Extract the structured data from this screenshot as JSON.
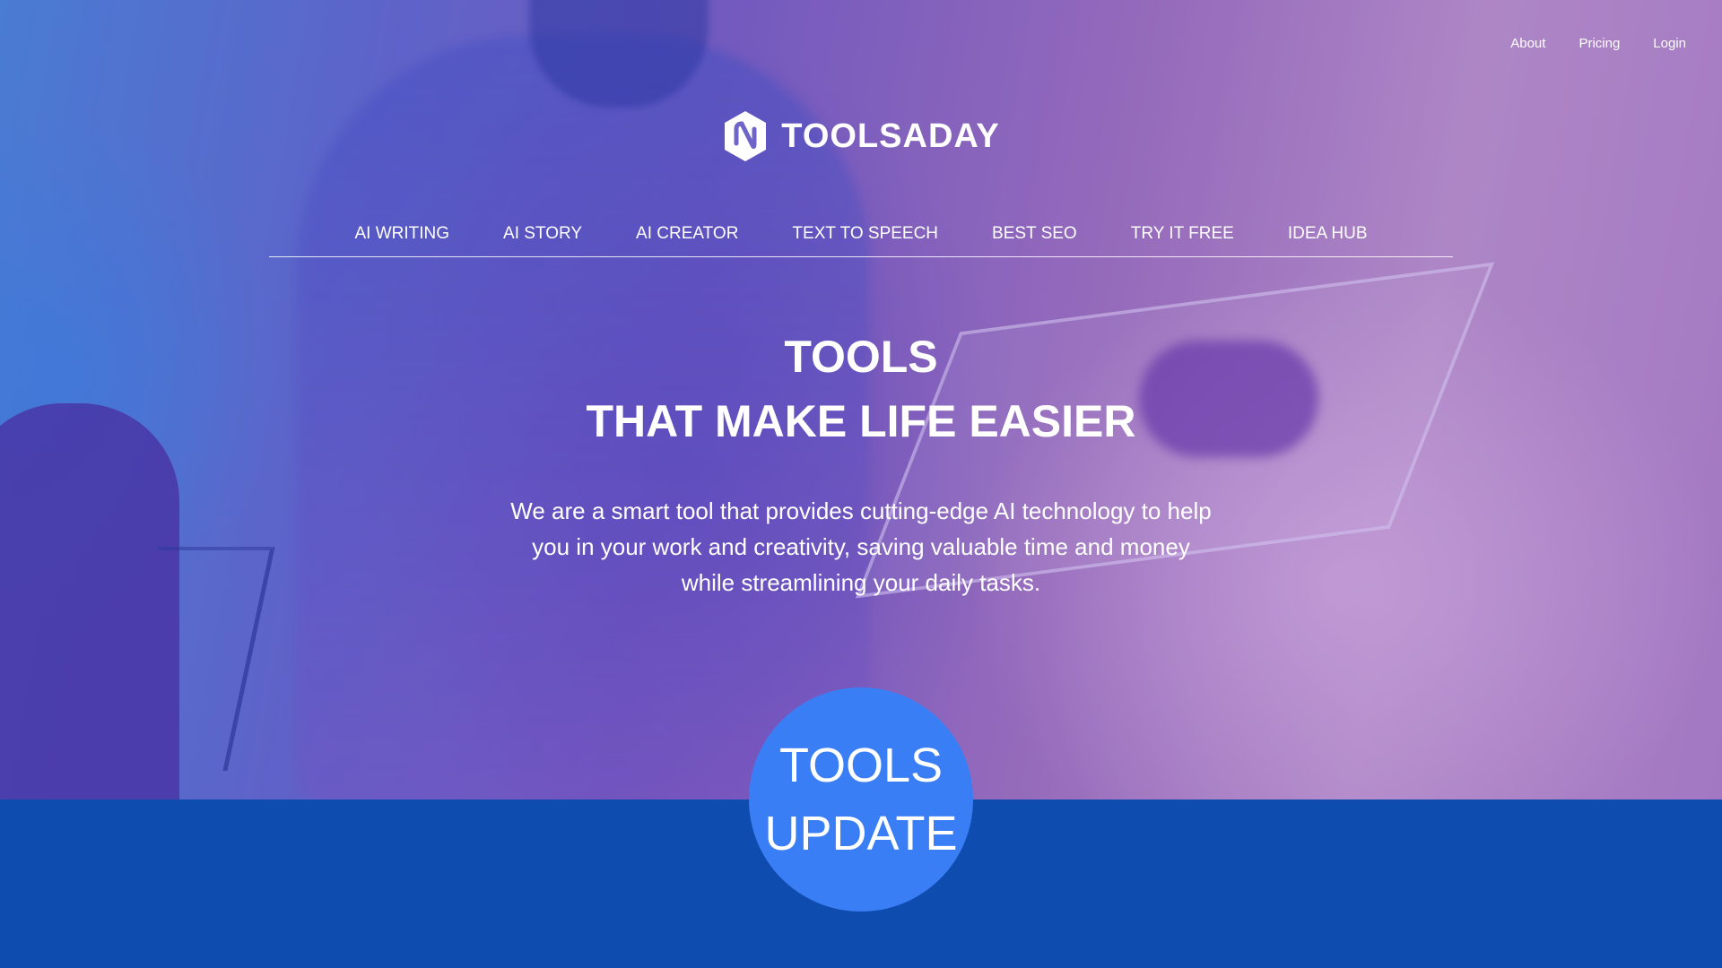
{
  "top_links": [
    {
      "label": "About"
    },
    {
      "label": "Pricing"
    },
    {
      "label": "Login"
    }
  ],
  "logo": {
    "text": "TOOLSADAY",
    "icon": "toolsaday-logo-icon"
  },
  "nav": [
    {
      "label": "AI WRITING"
    },
    {
      "label": "AI STORY"
    },
    {
      "label": "AI CREATOR"
    },
    {
      "label": "TEXT TO SPEECH"
    },
    {
      "label": "BEST SEO"
    },
    {
      "label": "TRY IT FREE"
    },
    {
      "label": "IDEA HUB"
    }
  ],
  "hero": {
    "title_line1": "TOOLS",
    "title_line2": "THAT MAKE LIFE EASIER",
    "description": "We are a smart tool that provides cutting-edge AI technology to help you in your work and creativity, saving valuable time and money while streamlining your daily tasks."
  },
  "badge": {
    "line1": "TOOLS",
    "line2": "UPDATE"
  },
  "colors": {
    "band": "#0f4caf",
    "badge": "#3a7ef5"
  }
}
